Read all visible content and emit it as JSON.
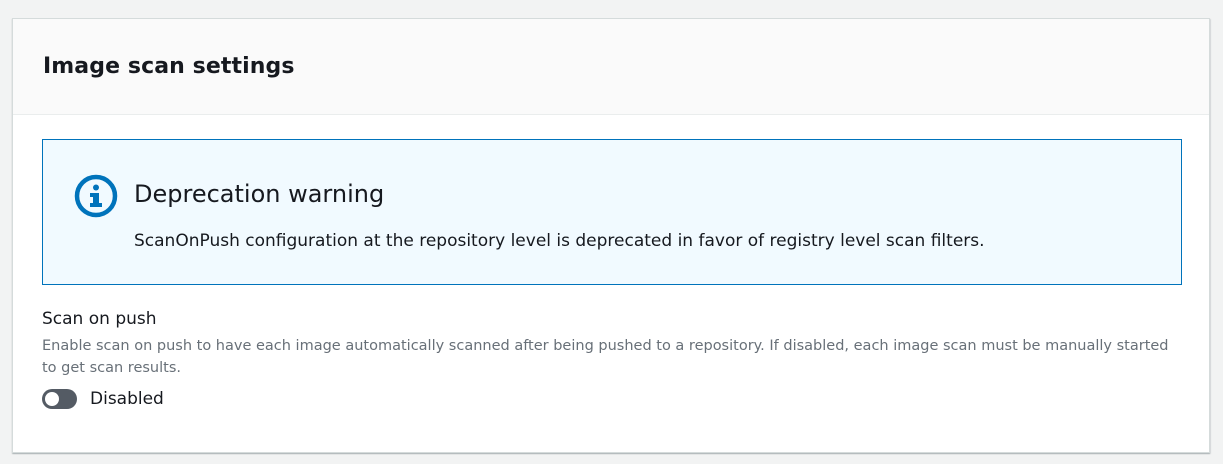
{
  "panel": {
    "title": "Image scan settings"
  },
  "alert": {
    "icon": "info-icon",
    "title": "Deprecation warning",
    "message": "ScanOnPush configuration at the repository level is deprecated in favor of registry level scan filters.",
    "accent_color": "#0073bb",
    "background_color": "#f1faff"
  },
  "scan_on_push": {
    "label": "Scan on push",
    "description": "Enable scan on push to have each image automatically scanned after being pushed to a repository. If disabled, each image scan must be manually started to get scan results.",
    "toggle": {
      "enabled": false,
      "state_label": "Disabled",
      "track_color": "#545b64"
    }
  }
}
